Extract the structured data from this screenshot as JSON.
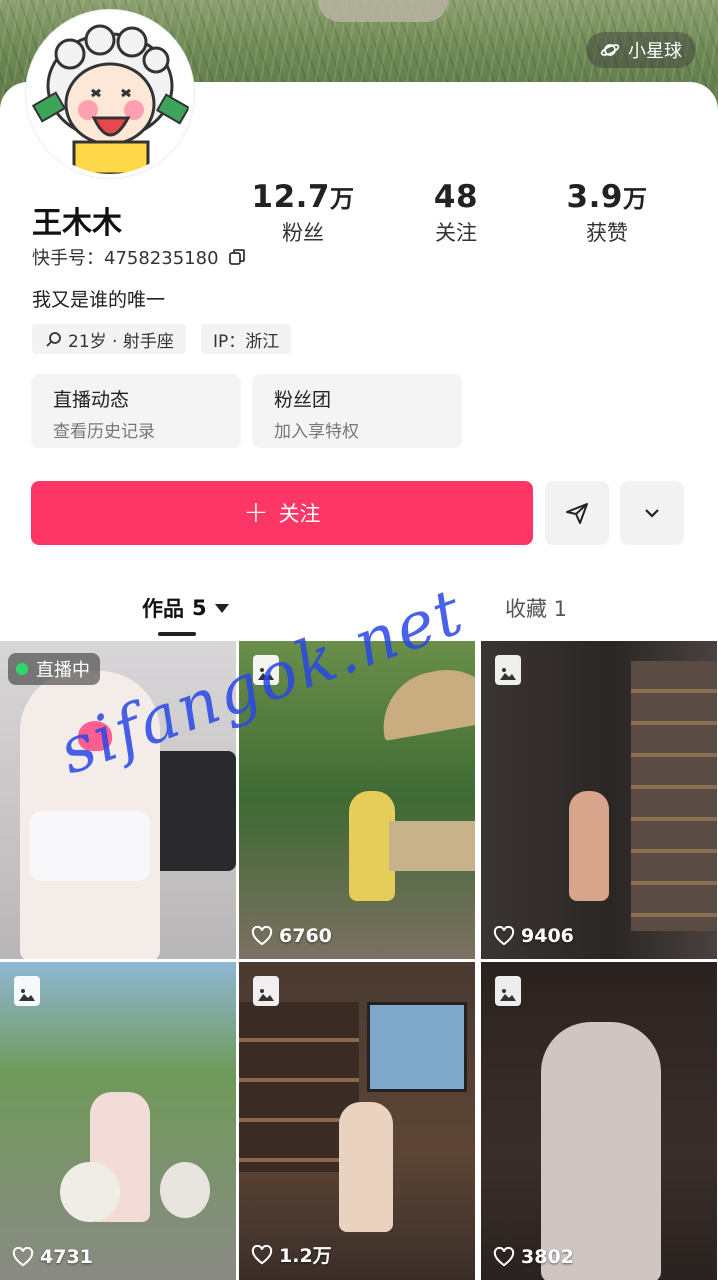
{
  "header": {
    "planet_label": "小星球"
  },
  "profile": {
    "stats": [
      {
        "value": "12.7",
        "unit": "万",
        "label": "粉丝"
      },
      {
        "value": "48",
        "unit": "",
        "label": "关注"
      },
      {
        "value": "3.9",
        "unit": "万",
        "label": "获赞"
      }
    ],
    "name": "王木木",
    "uid_label": "快手号：4758235180",
    "bio": "我又是谁的唯一",
    "tags": {
      "age_constellation": "21岁 · 射手座",
      "ip": "IP：浙江"
    },
    "features": [
      {
        "title": "直播动态",
        "subtitle": "查看历史记录"
      },
      {
        "title": "粉丝团",
        "subtitle": "加入享特权"
      }
    ]
  },
  "actions": {
    "follow_label": "关注"
  },
  "tabs": {
    "works_label": "作品",
    "works_count": "5",
    "favorites_label": "收藏 1"
  },
  "grid": {
    "live_badge": "直播中",
    "likes": [
      "6760",
      "9406",
      "4731",
      "1.2万",
      "3802"
    ]
  },
  "watermark": "sifangok.net",
  "colors": {
    "accent": "#fe3666",
    "live_dot": "#2bd96b",
    "watermark": "#2846e6"
  }
}
